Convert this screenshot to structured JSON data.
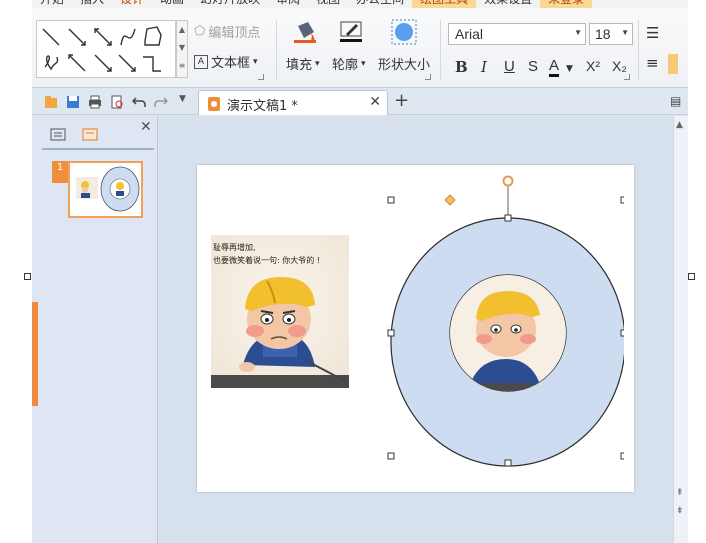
{
  "ribbon_tabs": [
    {
      "label": "开始",
      "state": "normal"
    },
    {
      "label": "插入",
      "state": "normal"
    },
    {
      "label": "设计",
      "state": "active"
    },
    {
      "label": "动画",
      "state": "normal"
    },
    {
      "label": "幻灯片放映",
      "state": "normal"
    },
    {
      "label": "审阅",
      "state": "normal"
    },
    {
      "label": "视图",
      "state": "normal"
    },
    {
      "label": "办公空间",
      "state": "normal"
    },
    {
      "label": "绘图工具",
      "state": "highlight"
    },
    {
      "label": "效果设置",
      "state": "normal"
    },
    {
      "label": "未登录",
      "state": "highlight"
    }
  ],
  "ribbon": {
    "edit_points_label": "编辑顶点",
    "textbox_label": "文本框",
    "fill_label": "填充",
    "outline_label": "轮廓",
    "shape_size_label": "形状大小",
    "font_name": "Arial",
    "font_size": "18",
    "bold": "B",
    "italic": "I",
    "underline": "U",
    "shadow": "S",
    "font_color": "A",
    "superscript": "X²",
    "subscript": "X₂",
    "dropdown_arrow": "▾"
  },
  "doc_tab": {
    "title": "演示文稿1 *",
    "close": "✕",
    "new_tab": "+"
  },
  "left_panel": {
    "close": "✕",
    "slide_number": "1"
  },
  "slide": {
    "picture_caption_line1": "耻辱再增加,",
    "picture_caption_line2": "也要微笑着说一句: 你大爷的 !"
  },
  "colors": {
    "donut_fill": "#cddcf0",
    "accent_orange": "#f08f3a",
    "handle_orange": "#f4a261"
  },
  "icons": [
    "save-icon",
    "folder-icon",
    "print-icon",
    "undo-icon",
    "redo-icon",
    "paint-bucket-icon",
    "pen-outline-icon",
    "shape-size-icon",
    "textbox-icon",
    "edit-points-icon"
  ]
}
